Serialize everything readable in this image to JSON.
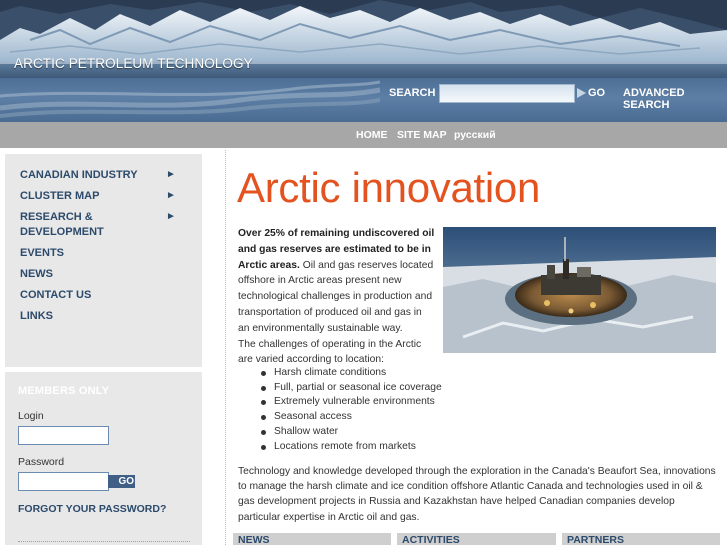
{
  "header": {
    "brand": "ARCTIC PETROLEUM TECHNOLOGY",
    "logo_icon": "glacier-banner-image"
  },
  "search": {
    "label": "SEARCH",
    "value": "",
    "placeholder": "",
    "go_label": "GO",
    "advanced_label": "ADVANCED SEARCH"
  },
  "topnav": {
    "items": [
      "HOME",
      "SITE MAP",
      "русский"
    ]
  },
  "sidebar": {
    "menu": [
      {
        "label": "CANADIAN INDUSTRY",
        "has_arrow": true,
        "arrow": "►"
      },
      {
        "label": "CLUSTER MAP",
        "has_arrow": true,
        "arrow": "►"
      },
      {
        "label": "RESEARCH &",
        "label2": "DEVELOPMENT",
        "has_arrow": true,
        "arrow": "►"
      },
      {
        "label": "EVENTS",
        "has_arrow": false
      },
      {
        "label": "NEWS",
        "has_arrow": false
      },
      {
        "label": "CONTACT US",
        "has_arrow": false
      },
      {
        "label": "LINKS",
        "has_arrow": false
      }
    ],
    "members": {
      "title": "MEMBERS ONLY",
      "login_label": "Login",
      "login_value": "",
      "password_label": "Password",
      "password_value": "",
      "go_label": "GO",
      "forgot_label": "FORGOT YOUR PASSWORD?"
    }
  },
  "main": {
    "headline": "Arctic innovation",
    "intro_bold": "Over 25% of remaining undiscovered oil and gas reserves are estimated to be in Arctic areas.",
    "intro_rest": " Oil and gas reserves located offshore in Arctic areas present new technological challenges in production and transportation of produced oil and gas in an environmentally sustainable way.",
    "intro_line2": "The challenges of operating in the Arctic are varied according to location:",
    "photo_icon": "offshore-ice-platform-photo",
    "bullets": [
      "Harsh climate conditions",
      "Full, partial or seasonal ice coverage",
      "Extremely vulnerable environments",
      "Seasonal access",
      "Shallow water",
      "Locations remote from markets"
    ],
    "paragraph": "Technology and knowledge developed through the exploration in the Canada's Beaufort Sea, innovations to manage the harsh climate and ice condition offshore Atlantic Canada and technologies used in oil & gas development projects in Russia and Kazakhstan have helped Canadian companies develop particular expertise in Arctic oil and gas.",
    "bottom_tabs": [
      "NEWS",
      "ACTIVITIES",
      "PARTNERS"
    ]
  },
  "colors": {
    "accent": "#e4531f",
    "nav_text": "#2c4a6b",
    "topnav_bg": "#a7a7a7",
    "panel_bg": "#e8e8e8"
  }
}
